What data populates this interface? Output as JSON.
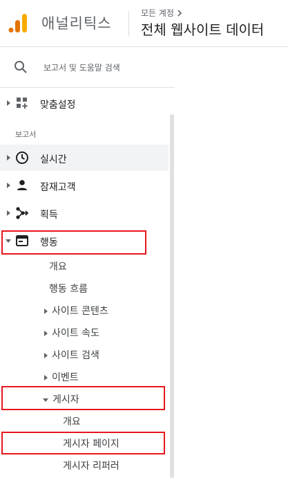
{
  "header": {
    "app_name": "애널리틱스",
    "account_crumb": "모든 계정",
    "view_title": "전체 웹사이트 데이터",
    "logo_colors": [
      "#f9ab00",
      "#e37400"
    ]
  },
  "search": {
    "label": "보고서 및 도움말 검색"
  },
  "nav": {
    "customization": {
      "label": "맞춤설정",
      "icon": "dashboard-icon"
    },
    "section_label": "보고서",
    "items": [
      {
        "label": "실시간",
        "icon": "clock-icon"
      },
      {
        "label": "잠재고객",
        "icon": "person-icon"
      },
      {
        "label": "획득",
        "icon": "acquisition-icon"
      },
      {
        "label": "행동",
        "icon": "behavior-icon"
      }
    ],
    "behavior_children": [
      {
        "label": "개요"
      },
      {
        "label": "행동 흐름"
      },
      {
        "label": "사이트 콘텐츠"
      },
      {
        "label": "사이트 속도"
      },
      {
        "label": "사이트 검색"
      },
      {
        "label": "이벤트"
      },
      {
        "label": "게시자"
      }
    ],
    "publisher_children": [
      {
        "label": "개요"
      },
      {
        "label": "게시자 페이지"
      },
      {
        "label": "게시자 리퍼러"
      }
    ]
  },
  "highlight_color": "#e8141c"
}
